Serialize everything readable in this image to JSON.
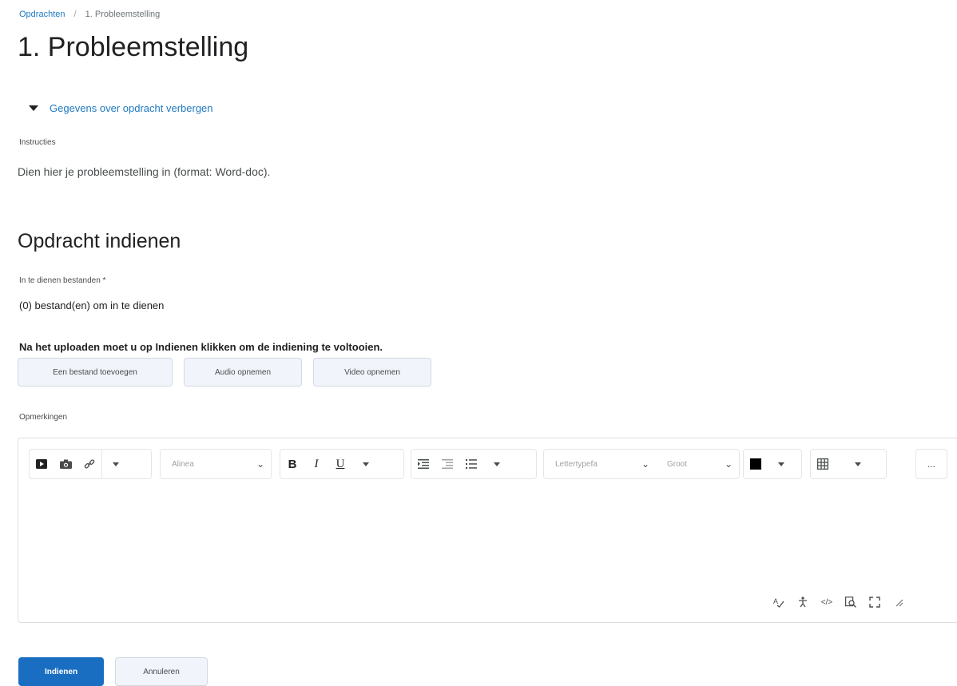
{
  "breadcrumb": {
    "parent": "Opdrachten",
    "current": "1. Probleemstelling"
  },
  "page_title": "1. Probleemstelling",
  "details_toggle": "Gegevens over opdracht verbergen",
  "instructions": {
    "label": "Instructies",
    "text": "Dien hier je probleemstelling in (format: Word-doc)."
  },
  "submit_section": {
    "title": "Opdracht indienen",
    "files_label": "In te dienen bestanden *",
    "files_count": "(0) bestand(en) om in te dienen",
    "notice": "Na het uploaden moet u op Indienen klikken om de indiening te voltooien.",
    "buttons": {
      "add_file": "Een bestand toevoegen",
      "record_audio": "Audio opnemen",
      "record_video": "Video opnemen"
    }
  },
  "comments": {
    "label": "Opmerkingen"
  },
  "editor": {
    "style_select": "Alinea",
    "font_select": "Lettertypefa",
    "size_select": "Groot",
    "text_color": "#000000",
    "icons": {
      "insert_video": "video-icon",
      "insert_image": "camera-icon",
      "insert_link": "link-icon",
      "bold": "B",
      "italic": "I",
      "underline": "U",
      "indent": "indent-icon",
      "outdent": "outdent-icon",
      "list": "list-icon",
      "table": "table-icon",
      "more": "..."
    }
  },
  "actions": {
    "submit": "Indienen",
    "cancel": "Annuleren"
  }
}
